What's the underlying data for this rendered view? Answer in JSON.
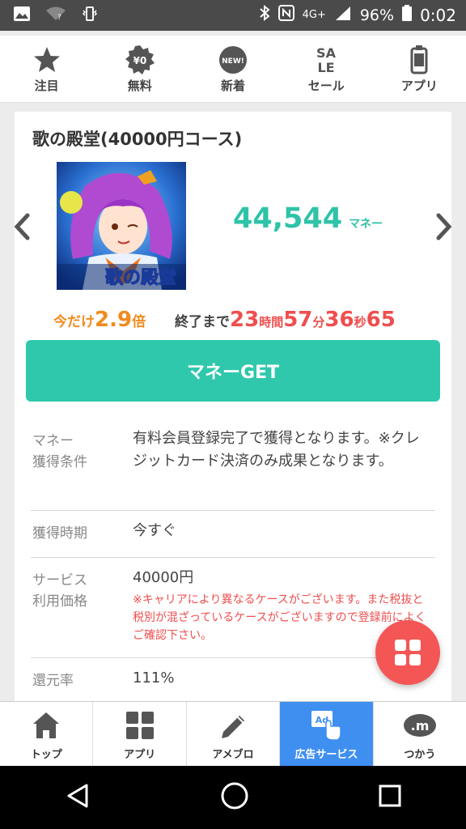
{
  "status_bar": {
    "network": "4G+",
    "battery": "96%",
    "time": "0:02"
  },
  "top_categories": [
    {
      "label": "注目",
      "icon": "star-icon"
    },
    {
      "label": "無料",
      "icon": "free-badge-icon",
      "badge": "¥0"
    },
    {
      "label": "新着",
      "icon": "new-badge-icon",
      "badge": "NEW!"
    },
    {
      "label": "セール",
      "icon": "sale-icon",
      "badge_line1": "SA",
      "badge_line2": "LE"
    },
    {
      "label": "アプリ",
      "icon": "smartphone-icon"
    }
  ],
  "offer": {
    "title": "歌の殿堂(40000円コース)",
    "thumbnail_logo": "歌の殿堂",
    "money_value": "44,544",
    "money_unit": "マネー",
    "promo_prefix": "今だけ",
    "promo_multiplier": "2.9",
    "promo_suffix": "倍",
    "timer_label": "終了まで",
    "hours": "23",
    "hours_unit": "時間",
    "minutes": "57",
    "minutes_unit": "分",
    "seconds": "36",
    "seconds_unit": "秒",
    "fraction": "65",
    "get_button": "マネーGET"
  },
  "details": [
    {
      "key_line1": "マネー",
      "key_line2": "獲得条件",
      "value": "有料会員登録完了で獲得となります。※クレジットカード決済のみ成果となります。"
    },
    {
      "key_line1": "獲得時期",
      "key_line2": "",
      "value": "今すぐ"
    },
    {
      "key_line1": "サービス",
      "key_line2": "利用価格",
      "value": "40000円",
      "note": "※キャリアにより異なるケースがございます。また税抜と税別が混ざっているケースがございますので登録前によくご確認下さい。"
    },
    {
      "key_line1": "還元率",
      "key_line2": "",
      "value": "111%"
    }
  ],
  "bottom_nav": [
    {
      "label": "トップ",
      "icon": "home-icon",
      "active": false
    },
    {
      "label": "アプリ",
      "icon": "grid-icon",
      "active": false
    },
    {
      "label": "アメブロ",
      "icon": "pencil-icon",
      "active": false
    },
    {
      "label": "広告サービス",
      "icon": "ad-tap-icon",
      "active": true
    },
    {
      "label": "つかう",
      "icon": "money-m-icon",
      "m": ".m",
      "active": false
    }
  ],
  "colors": {
    "accent": "#2fc8ac",
    "promo": "#f08b1e",
    "timer": "#ef4e4e",
    "active_tab": "#3f8ff0",
    "fab": "#f45656"
  }
}
